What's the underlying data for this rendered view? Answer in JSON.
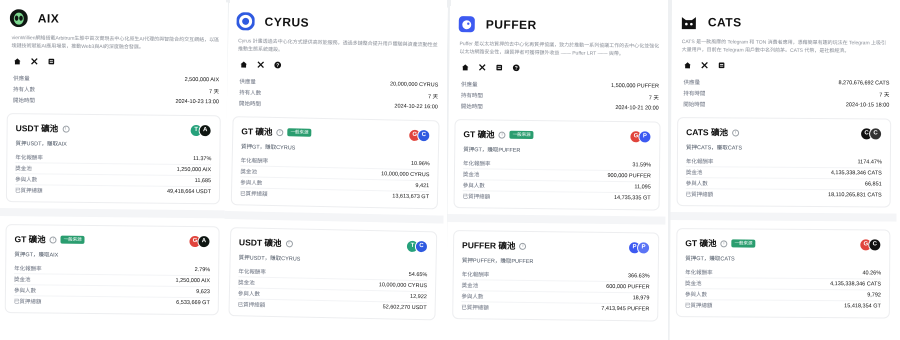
{
  "projects": [
    {
      "name": "AIX",
      "logo": "aix-alien-logo",
      "logo_bg": "#0f1612",
      "desc": "vienWillien網絡搭載Arbitrum生態中首次實現去中心化原生AI代理的與智能合約交互網絡，以區塊鏈技術賦能AI應用場景，推動Web3與AI的深度融合發展。",
      "socials": [
        "home-icon",
        "x-icon",
        "doc-icon"
      ],
      "info": [
        {
          "k": "供應量",
          "v": "2,500,000 AIX"
        },
        {
          "k": "持有人數",
          "v": "7 天"
        },
        {
          "k": "開始時間",
          "v": "2024-10-23 13:00"
        }
      ],
      "pools": [
        {
          "title": "USDT 礦池",
          "badge": "",
          "tokens": [
            {
              "sym": "T",
              "bg": "#26a17b"
            },
            {
              "sym": "A",
              "bg": "#0f1612"
            }
          ],
          "sub": "質押USDT，賺取AIX",
          "rows": [
            {
              "k": "年化報酬率",
              "v": "11.37%"
            },
            {
              "k": "獎金池",
              "v": "1,250,000 AIX"
            },
            {
              "k": "參與人數",
              "v": "11,685"
            },
            {
              "k": "已質押總額",
              "v": "49,418,664 USDT"
            }
          ]
        },
        {
          "title": "GT 礦池",
          "badge": "一般來源",
          "tokens": [
            {
              "sym": "G",
              "bg": "#e0443c"
            },
            {
              "sym": "A",
              "bg": "#0f1612"
            }
          ],
          "sub": "質押GT，賺取AIX",
          "rows": [
            {
              "k": "年化報酬率",
              "v": "2.79%"
            },
            {
              "k": "獎金池",
              "v": "1,250,000 AIX"
            },
            {
              "k": "參與人數",
              "v": "9,623"
            },
            {
              "k": "已質押總額",
              "v": "6,533,669 GT"
            }
          ]
        }
      ]
    },
    {
      "name": "CYRUS",
      "logo": "cyrus-logo",
      "logo_bg": "#2f5ae0",
      "desc": "Cyrus 計畫透過去中心化方式提供高效能服務，透過多鏈整合提升用戶體驗與資產流動性並推動生態系統建設。",
      "socials": [
        "home-icon",
        "x-icon",
        "help-icon"
      ],
      "info": [
        {
          "k": "供應量",
          "v": "20,000,000 CYRUS"
        },
        {
          "k": "持有人數",
          "v": "7 天"
        },
        {
          "k": "開始時間",
          "v": "2024-10-22 16:00"
        }
      ],
      "pools": [
        {
          "title": "GT 礦池",
          "badge": "一般來源",
          "tokens": [
            {
              "sym": "G",
              "bg": "#e0443c"
            },
            {
              "sym": "C",
              "bg": "#2f5ae0"
            }
          ],
          "sub": "質押GT，賺取CYRUS",
          "rows": [
            {
              "k": "年化報酬率",
              "v": "10.96%"
            },
            {
              "k": "獎金池",
              "v": "10,000,000 CYRUS"
            },
            {
              "k": "參與人數",
              "v": "9,421"
            },
            {
              "k": "已質押總額",
              "v": "13,613,673 GT"
            }
          ]
        },
        {
          "title": "USDT 礦池",
          "badge": "",
          "tokens": [
            {
              "sym": "T",
              "bg": "#26a17b"
            },
            {
              "sym": "C",
              "bg": "#2f5ae0"
            }
          ],
          "sub": "質押USDT，賺取CYRUS",
          "rows": [
            {
              "k": "年化報酬率",
              "v": "54.65%"
            },
            {
              "k": "獎金池",
              "v": "10,000,000 CYRUS"
            },
            {
              "k": "參與人數",
              "v": "12,922"
            },
            {
              "k": "已質押總額",
              "v": "52,602,270 USDT"
            }
          ]
        }
      ]
    },
    {
      "name": "PUFFER",
      "logo": "puffer-logo",
      "logo_bg": "#3d5af1",
      "desc": "Puffer 是以太坊質押的去中心化再質押協議，致力於推動一系列協議工作的去中心化並強化以太坊網路安全性，讓質押者可獲得額外收益 —— Puffer LRT —— 與帶。",
      "socials": [
        "home-icon",
        "x-icon",
        "doc-icon",
        "help-icon"
      ],
      "info": [
        {
          "k": "供應量",
          "v": "1,500,000 PUFFER"
        },
        {
          "k": "持有時間",
          "v": "7 天"
        },
        {
          "k": "開始時間",
          "v": "2024-10-21 20:00"
        }
      ],
      "pools": [
        {
          "title": "GT 礦池",
          "badge": "一般來源",
          "tokens": [
            {
              "sym": "G",
              "bg": "#e0443c"
            },
            {
              "sym": "P",
              "bg": "#3d5af1"
            }
          ],
          "sub": "質押GT，賺取PUFFER",
          "rows": [
            {
              "k": "年化報酬率",
              "v": "31.59%"
            },
            {
              "k": "獎金池",
              "v": "900,000 PUFFER"
            },
            {
              "k": "參與人數",
              "v": "11,095"
            },
            {
              "k": "已質押總額",
              "v": "14,735,335 GT"
            }
          ]
        },
        {
          "title": "PUFFER 礦池",
          "badge": "",
          "tokens": [
            {
              "sym": "P",
              "bg": "#3d5af1"
            },
            {
              "sym": "P",
              "bg": "#5b74f5"
            }
          ],
          "sub": "質押PUFFER，賺取PUFFER",
          "rows": [
            {
              "k": "年化報酬率",
              "v": "366.63%"
            },
            {
              "k": "獎金池",
              "v": "600,000 PUFFER"
            },
            {
              "k": "參與人數",
              "v": "18,979"
            },
            {
              "k": "已質押總額",
              "v": "7,413,945 PUFFER"
            }
          ]
        }
      ]
    },
    {
      "name": "CATS",
      "logo": "cats-logo",
      "logo_bg": "#111111",
      "desc": "CATS 是一款風靡的 Telegram 和 TON 消費者應用，憑藉簡單有趣的玩法在 Telegram 上吸引大量用戶，目前在 Telegram 用戶數中名列前茅。CATS 代幣，是社群經濟。",
      "socials": [
        "home-icon",
        "x-icon",
        "doc-icon"
      ],
      "info": [
        {
          "k": "供應量",
          "v": "8,270,676,692 CATS"
        },
        {
          "k": "持有時間",
          "v": "7 天"
        },
        {
          "k": "開始時間",
          "v": "2024-10-15 18:00"
        }
      ],
      "pools": [
        {
          "title": "CATS 礦池",
          "badge": "",
          "tokens": [
            {
              "sym": "C",
              "bg": "#111111"
            },
            {
              "sym": "C",
              "bg": "#333333"
            }
          ],
          "sub": "質押CATS，賺取CATS",
          "rows": [
            {
              "k": "年化報酬率",
              "v": "1174.47%"
            },
            {
              "k": "獎金池",
              "v": "4,135,338,346 CATS"
            },
            {
              "k": "參與人數",
              "v": "66,851"
            },
            {
              "k": "已質押總額",
              "v": "18,110,265,831 CATS"
            }
          ]
        },
        {
          "title": "GT 礦池",
          "badge": "一般來源",
          "tokens": [
            {
              "sym": "G",
              "bg": "#e0443c"
            },
            {
              "sym": "C",
              "bg": "#111111"
            }
          ],
          "sub": "質押GT，賺取CATS",
          "rows": [
            {
              "k": "年化報酬率",
              "v": "40.26%"
            },
            {
              "k": "獎金池",
              "v": "4,135,338,346 CATS"
            },
            {
              "k": "參與人數",
              "v": "9,792"
            },
            {
              "k": "已質押總額",
              "v": "15,418,354 GT"
            }
          ]
        }
      ]
    }
  ]
}
